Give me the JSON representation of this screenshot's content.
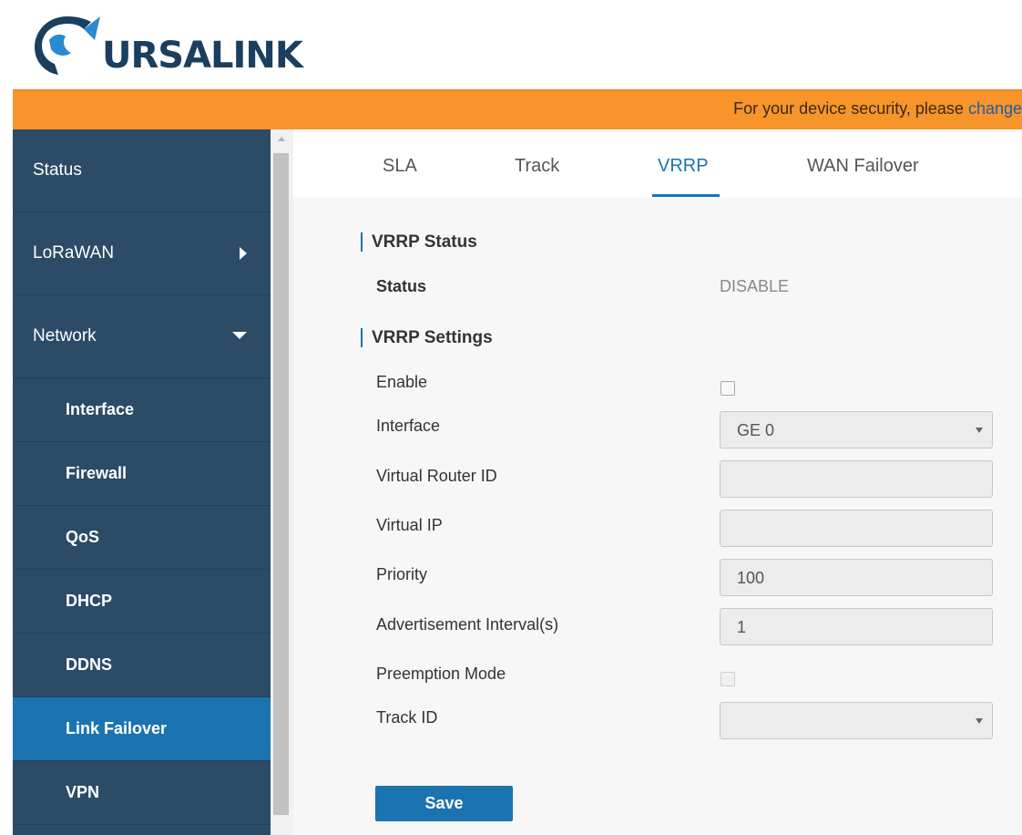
{
  "brand": {
    "name": "URSALINK"
  },
  "notice": {
    "text": "For your device security, please ",
    "link": "change"
  },
  "sidebar": {
    "items": [
      {
        "label": "Status"
      },
      {
        "label": "LoRaWAN"
      },
      {
        "label": "Network"
      }
    ],
    "subitems": [
      {
        "label": "Interface"
      },
      {
        "label": "Firewall"
      },
      {
        "label": "QoS"
      },
      {
        "label": "DHCP"
      },
      {
        "label": "DDNS"
      },
      {
        "label": "Link Failover"
      },
      {
        "label": "VPN"
      }
    ]
  },
  "tabs": [
    "SLA",
    "Track",
    "VRRP",
    "WAN Failover"
  ],
  "vrrp_status": {
    "title": "VRRP Status",
    "status_label": "Status",
    "status_value": "DISABLE"
  },
  "vrrp_settings": {
    "title": "VRRP Settings",
    "enable_label": "Enable",
    "interface_label": "Interface",
    "interface_value": "GE 0",
    "vrid_label": "Virtual Router ID",
    "vrid_value": "",
    "vip_label": "Virtual IP",
    "vip_value": "",
    "priority_label": "Priority",
    "priority_value": "100",
    "adv_label": "Advertisement Interval(s)",
    "adv_value": "1",
    "preempt_label": "Preemption Mode",
    "track_label": "Track ID",
    "track_value": ""
  },
  "save_label": "Save",
  "colors": {
    "accent": "#1b74b0",
    "sidebar": "#2b4b66",
    "banner": "#f7942a"
  }
}
